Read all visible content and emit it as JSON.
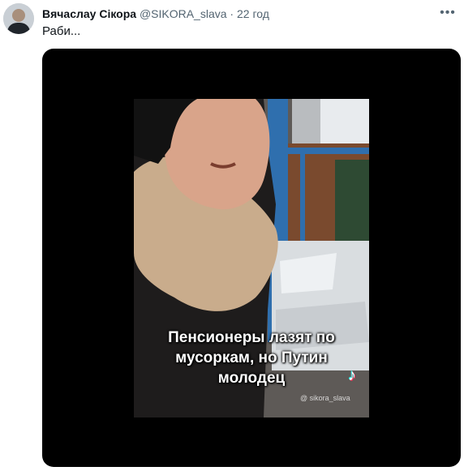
{
  "tweet": {
    "author_name": "Вячаслау Сікора",
    "handle": "@SIKORA_slava",
    "separator": "·",
    "time": "22 год",
    "text": "Раби...",
    "more_icon": "more-horizontal-icon"
  },
  "media": {
    "caption_lines": [
      "Пенсионеры лазят по",
      "мусоркам, но Путин",
      "молодец"
    ],
    "watermark": "@ sikora_slava",
    "logo_icon": "tiktok-icon"
  },
  "colors": {
    "name": "#0f1419",
    "secondary": "#536471",
    "media_background": "#000000",
    "fence_blue": "#2f6fae"
  }
}
